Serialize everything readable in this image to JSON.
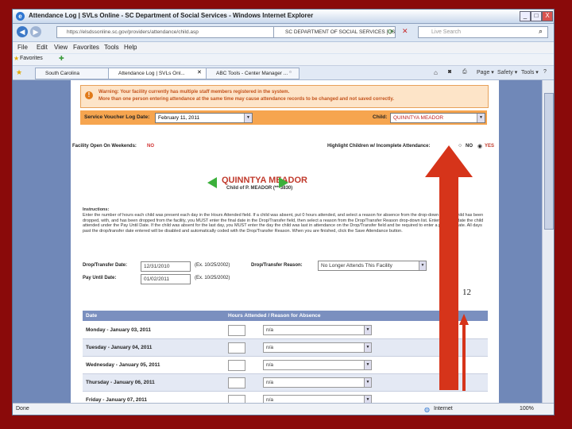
{
  "window": {
    "title": "Attendance Log | SVLs Online - SC Department of Social Services - Windows Internet Explorer",
    "controls": [
      "_",
      "□",
      "X"
    ]
  },
  "address": {
    "url": "https://elsdssonline.sc.gov/providers/attendance/child.asp",
    "site_id": "SC DEPARTMENT OF SOCIAL SERVICES [US]",
    "search_placeholder": "Live Search"
  },
  "menu": [
    "File",
    "Edit",
    "View",
    "Favorites",
    "Tools",
    "Help"
  ],
  "favorites": {
    "label": "Favorites"
  },
  "tabs": [
    {
      "label": "South Carolina"
    },
    {
      "label": "Attendance Log | SVLs Onl..."
    },
    {
      "label": "ABC Tools - Center Manager ..."
    }
  ],
  "toolbar_tools": [
    "Page ▾",
    "Safety ▾",
    "Tools ▾",
    "?"
  ],
  "warning": {
    "line1": "Warning: Your facility currently has multiple staff members registered in the system.",
    "line2": "More than one person entering attendance at the same time may cause attendance records to be changed and not saved correctly."
  },
  "voucher_bar": {
    "date_label": "Service Voucher Log Date:",
    "date_value": "February 11, 2011",
    "child_label": "Child:",
    "child_value": "QUINNTYA MEADOR"
  },
  "weekend": {
    "label": "Facility Open On Weekends:",
    "value": "NO"
  },
  "highlight": {
    "label": "Highlight Children w/ Incomplete Attendance:",
    "no": "NO",
    "yes": "YES"
  },
  "child": {
    "name": "QUINNTYA MEADOR",
    "sub": "Child of P. MEADOR (***3830)"
  },
  "instructions": {
    "title": "Instructions:",
    "text": "Enter the number of hours each child was present each day in the Hours Attended field. If a child was absent, put 0 hours attended, and select a reason for absence from the drop-down list. If a child has been dropped, with, and has been dropped from the facility, you MUST enter the final date in the Drop/Transfer field, then select a reason from the Drop/Transfer Reason drop-down list. Enter the final date the child attended under the Pay Until Date. If the child was absent for the last day, you MUST enter the day the child was last in attendance on the Drop/Transfer field and be required to enter a pay until date. All days past the drop/transfer date entered will be disabled and automatically coded with the Drop/Transfer Reason. When you are finished, click the Save Attendance button."
  },
  "drop": {
    "label": "Drop/Transfer Date:",
    "value": "12/31/2010",
    "example": "(Ex. 10/25/2002)",
    "reason_label": "Drop/Transfer Reason:",
    "reason_value": "No Longer Attends This Facility"
  },
  "pay": {
    "label": "Pay Until Date:",
    "value": "01/02/2011",
    "example": "(Ex. 10/25/2002)"
  },
  "annotation": "12",
  "grid": {
    "col_date": "Date",
    "col_hours": "Hours Attended / Reason for Absence",
    "rows": [
      {
        "date": "Monday - January 03, 2011",
        "reason": "n/a"
      },
      {
        "date": "Tuesday - January 04, 2011",
        "reason": "n/a"
      },
      {
        "date": "Wednesday - January 05, 2011",
        "reason": "n/a"
      },
      {
        "date": "Thursday - January 06, 2011",
        "reason": "n/a"
      },
      {
        "date": "Friday - January 07, 2011",
        "reason": "n/a"
      }
    ]
  },
  "status": {
    "left": "Done",
    "zone": "Internet",
    "zoom": "100%"
  },
  "colors": {
    "arrow": "#d6341a",
    "background": "#8a0a0a",
    "child_name": "#c0392b"
  }
}
